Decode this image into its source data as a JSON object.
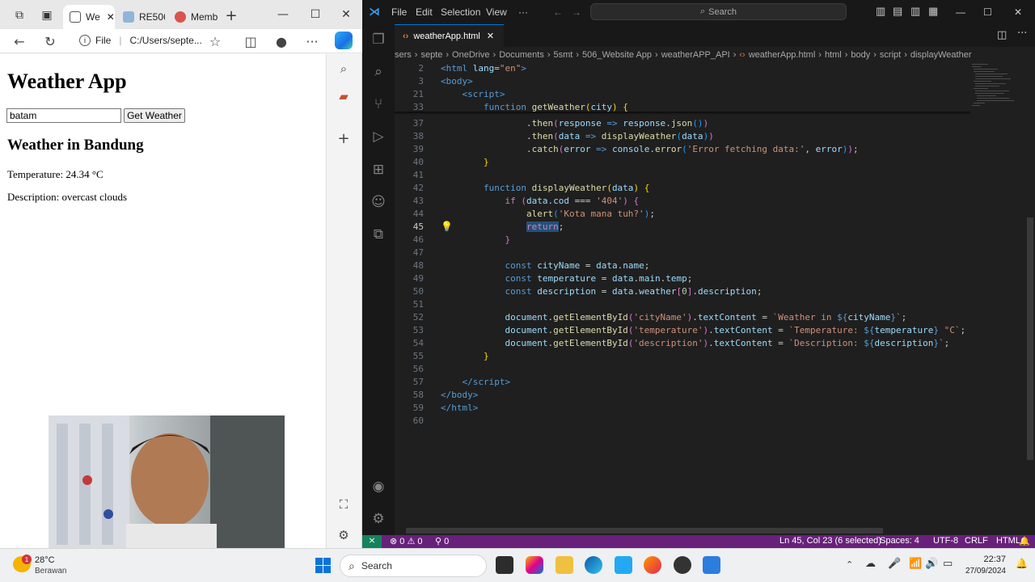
{
  "browser": {
    "tabs": [
      {
        "label": "We"
      },
      {
        "label": "RE506"
      },
      {
        "label": "Membe"
      }
    ],
    "url_label": "File",
    "url": "C:/Users/septe...",
    "page": {
      "title": "Weather App",
      "input_value": "batam",
      "button_label": "Get Weather",
      "city_heading": "Weather in Bandung",
      "temperature": "Temperature: 24.34 °C",
      "description": "Description: overcast clouds"
    }
  },
  "vscode": {
    "menu": [
      "File",
      "Edit",
      "Selection",
      "View",
      "···"
    ],
    "search_placeholder": "Search",
    "active_tab": "weatherApp.html",
    "breadcrumbs": [
      "sers",
      "septe",
      "OneDrive",
      "Documents",
      "5smt",
      "506_Website App",
      "weatherAPP_API",
      "weatherApp.html",
      "html",
      "body",
      "script",
      "displayWeather"
    ],
    "status": {
      "errors": "0",
      "warnings": "0",
      "ports": "0",
      "cursor": "Ln 45, Col 23 (6 selected)",
      "spaces": "Spaces: 4",
      "encoding": "UTF-8",
      "eol": "CRLF",
      "language": "HTML"
    }
  },
  "taskbar": {
    "weather_temp": "28°C",
    "weather_desc": "Berawan",
    "weather_badge": "1",
    "search_label": "Search",
    "time": "22:37",
    "date": "27/09/2024"
  },
  "colors": {
    "vscode_status": "#68217a",
    "accent": "#0078d4"
  }
}
